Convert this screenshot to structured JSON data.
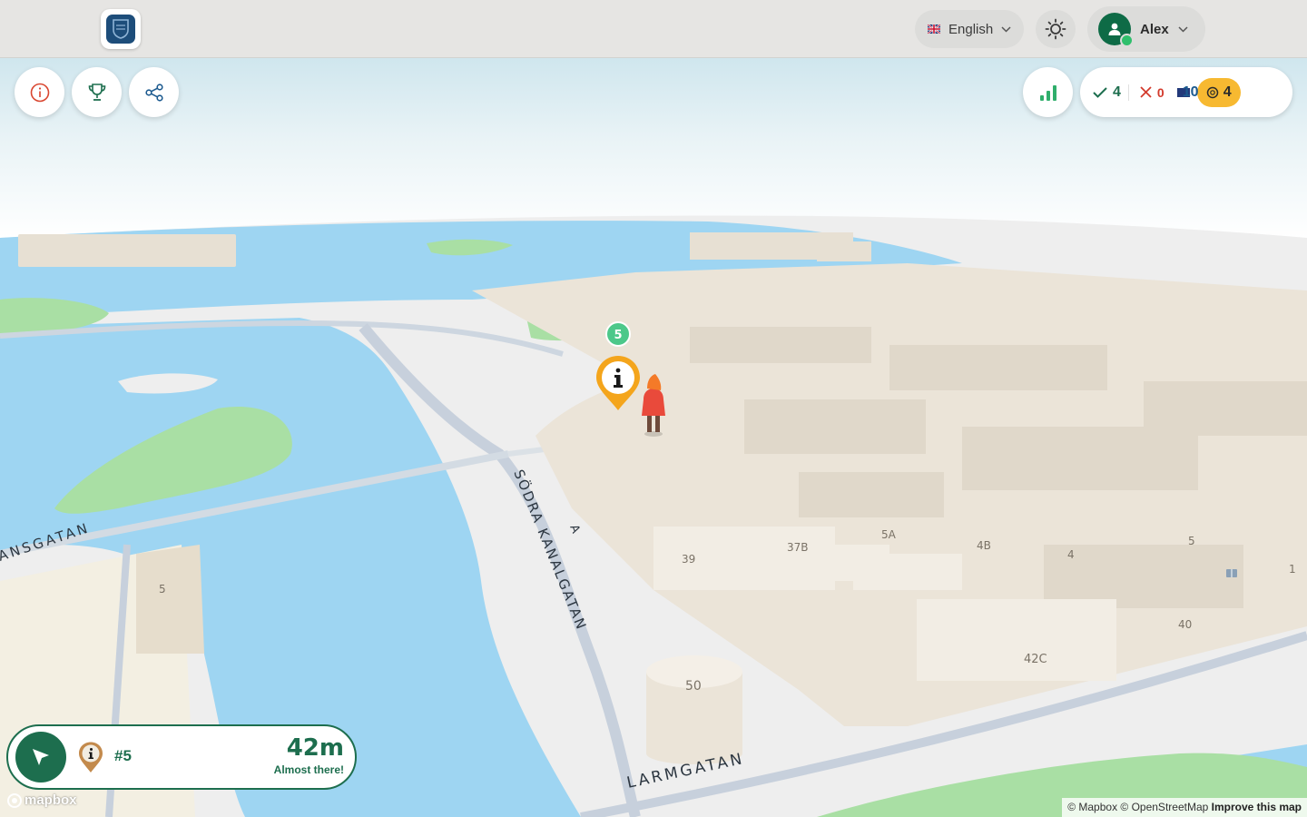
{
  "header": {
    "language": "English",
    "user_name": "Alex"
  },
  "stats": {
    "correct": "4",
    "wrong": "0",
    "flags": "10",
    "coins": "4"
  },
  "navigation": {
    "poi_number": "#5",
    "distance": "42m",
    "message": "Almost there!"
  },
  "map": {
    "cluster_badge": "5",
    "streets": [
      "SÖDRA KANALGATAN",
      "LARMGATAN",
      "ANSGATAN"
    ],
    "street_fragment": "A",
    "house_numbers": [
      "39",
      "37B",
      "5A",
      "4B",
      "4",
      "5",
      "1",
      "40",
      "42C",
      "50",
      "5"
    ],
    "attribution_prefix": "© Mapbox © OpenStreetMap",
    "attribution_link": "Improve this map",
    "logo_text": "mapbox"
  },
  "colors": {
    "primary": "#1d6e4e",
    "water": "#9ed5f2",
    "park": "#a9dfa4",
    "building": "#ebe4d8",
    "coin": "#f7b931",
    "wrong": "#d33a2c",
    "flag": "#1c5a8f"
  }
}
